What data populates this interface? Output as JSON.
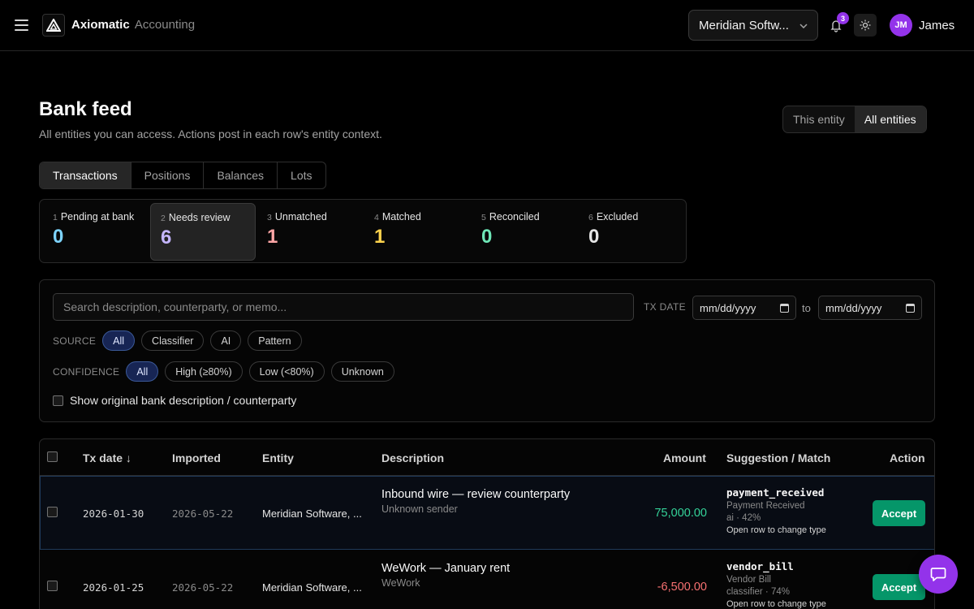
{
  "app": {
    "brand": "Axiomatic",
    "brand_sub": "Accounting",
    "entity_selector": "Meridian Softw...",
    "notifications_count": "3",
    "user_initials": "JM",
    "user_name": "James"
  },
  "header": {
    "title": "Bank feed",
    "subtitle": "All entities you can access. Actions post in each row's entity context.",
    "scope_this": "This entity",
    "scope_all": "All entities"
  },
  "tabs": [
    "Transactions",
    "Positions",
    "Balances",
    "Lots"
  ],
  "status": [
    {
      "num": "1",
      "label": "Pending at bank",
      "count": "0",
      "color": "#7dd3fc"
    },
    {
      "num": "2",
      "label": "Needs review",
      "count": "6",
      "color": "#c4b5fd"
    },
    {
      "num": "3",
      "label": "Unmatched",
      "count": "1",
      "color": "#fca5a5"
    },
    {
      "num": "4",
      "label": "Matched",
      "count": "1",
      "color": "#fcd34d"
    },
    {
      "num": "5",
      "label": "Reconciled",
      "count": "0",
      "color": "#6ee7b7"
    },
    {
      "num": "6",
      "label": "Excluded",
      "count": "0",
      "color": "#e5e5e5"
    }
  ],
  "filters": {
    "search_placeholder": "Search description, counterparty, or memo...",
    "tx_date_label": "TX DATE",
    "date_from": "mm/dd/yyyy",
    "to_label": "to",
    "date_to": "mm/dd/yyyy",
    "source_label": "SOURCE",
    "source_options": [
      "All",
      "Classifier",
      "AI",
      "Pattern"
    ],
    "confidence_label": "CONFIDENCE",
    "confidence_options": [
      "All",
      "High (≥80%)",
      "Low (<80%)",
      "Unknown"
    ],
    "show_original_label": "Show original bank description / counterparty"
  },
  "table": {
    "headers": {
      "tx_date": "Tx date ↓",
      "imported": "Imported",
      "entity": "Entity",
      "description": "Description",
      "amount": "Amount",
      "suggestion": "Suggestion / Match",
      "action": "Action"
    },
    "rows": [
      {
        "tx_date": "2026-01-30",
        "imported": "2026-05-22",
        "entity": "Meridian Software, ...",
        "description": "Inbound wire — review counterparty",
        "counterparty": "Unknown sender",
        "amount": "75,000.00",
        "amount_color": "#34d399",
        "suggestion_code": "payment_received",
        "suggestion_name": "Payment Received",
        "suggestion_meta": "ai · 42%",
        "suggestion_hint": "Open row to change type",
        "action": "Accept"
      },
      {
        "tx_date": "2026-01-25",
        "imported": "2026-05-22",
        "entity": "Meridian Software, ...",
        "description": "WeWork — January rent",
        "counterparty": "WeWork",
        "amount": "-6,500.00",
        "amount_color": "#f87171",
        "suggestion_code": "vendor_bill",
        "suggestion_name": "Vendor Bill",
        "suggestion_meta": "classifier · 74%",
        "suggestion_hint": "Open row to change type",
        "action": "Accept"
      }
    ]
  }
}
